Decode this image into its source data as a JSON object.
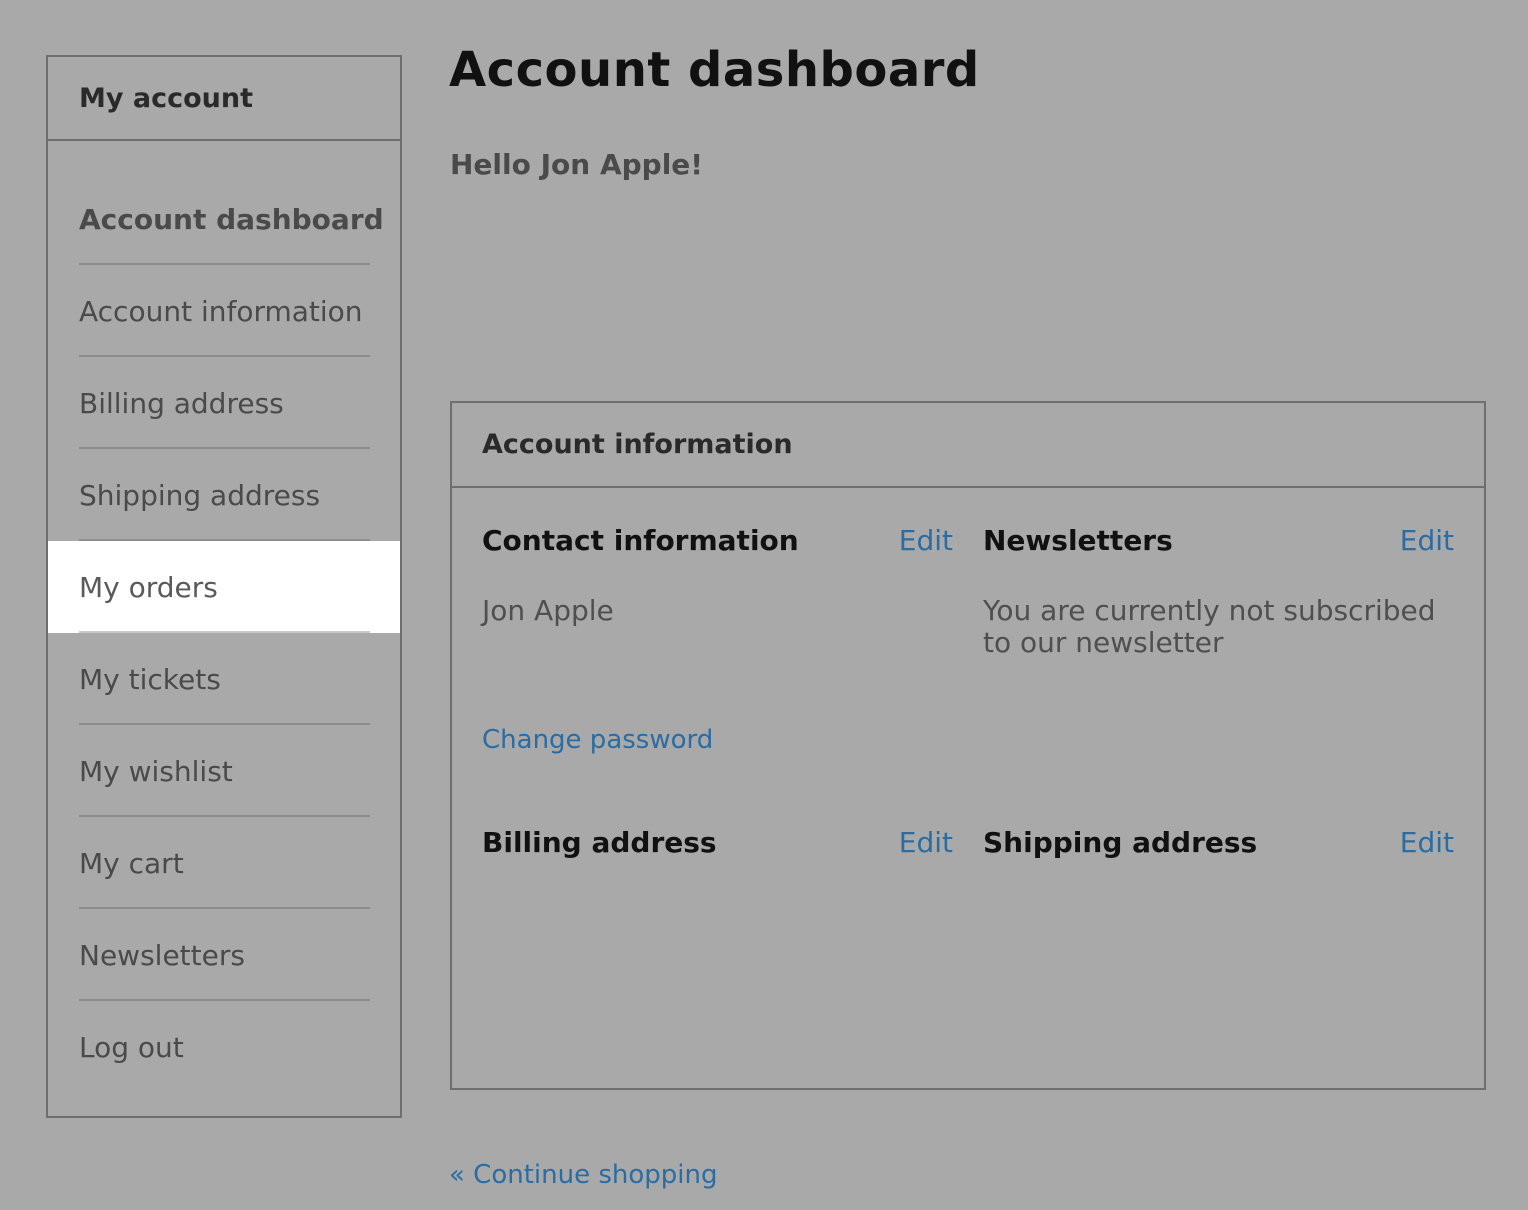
{
  "sidebar": {
    "title": "My account",
    "items": [
      {
        "label": "Account dashboard"
      },
      {
        "label": "Account information"
      },
      {
        "label": "Billing address"
      },
      {
        "label": "Shipping address"
      },
      {
        "label": "My orders"
      },
      {
        "label": "My tickets"
      },
      {
        "label": "My wishlist"
      },
      {
        "label": "My cart"
      },
      {
        "label": "Newsletters"
      },
      {
        "label": "Log out"
      }
    ]
  },
  "main": {
    "title": "Account dashboard",
    "greeting": "Hello Jon Apple!",
    "account_info": {
      "heading": "Account information",
      "contact": {
        "title": "Contact information",
        "edit_label": "Edit",
        "name": "Jon Apple"
      },
      "newsletters": {
        "title": "Newsletters",
        "edit_label": "Edit",
        "status": "You are currently not subscribed to our newsletter"
      },
      "change_password_label": "Change password",
      "billing": {
        "title": "Billing address",
        "edit_label": "Edit"
      },
      "shipping": {
        "title": "Shipping address",
        "edit_label": "Edit"
      }
    },
    "continue_shopping_label": "« Continue shopping"
  },
  "colors": {
    "background": "#a9a9a9",
    "link": "#2b6ca3",
    "highlight": "#ffffff"
  }
}
